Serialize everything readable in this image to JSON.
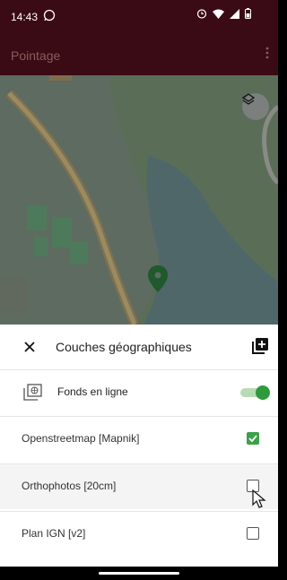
{
  "status_bar": {
    "time": "14:43",
    "icons": [
      "whatsapp-icon",
      "alarm-icon",
      "wifi-icon",
      "signal-icon",
      "battery-icon"
    ]
  },
  "app_bar": {
    "title": "Pointage",
    "menu_icon": "more-vertical-icon"
  },
  "map": {
    "layers_button_icon": "layers-icon",
    "marker_icon": "map-pin-icon"
  },
  "sheet": {
    "title": "Couches géographiques",
    "close_icon": "close-icon",
    "add_icon": "add-layer-icon",
    "online_section": {
      "label": "Fonds en ligne",
      "enabled": true
    },
    "layers": [
      {
        "label": "Openstreetmap [Mapnik]",
        "checked": true
      },
      {
        "label": "Orthophotos [20cm]",
        "checked": false
      },
      {
        "label": "Plan IGN [v2]",
        "checked": false
      }
    ]
  },
  "colors": {
    "app_bar": "#3a0b14",
    "accent_green": "#3aa148",
    "map_overlay": "#5d6a61"
  }
}
